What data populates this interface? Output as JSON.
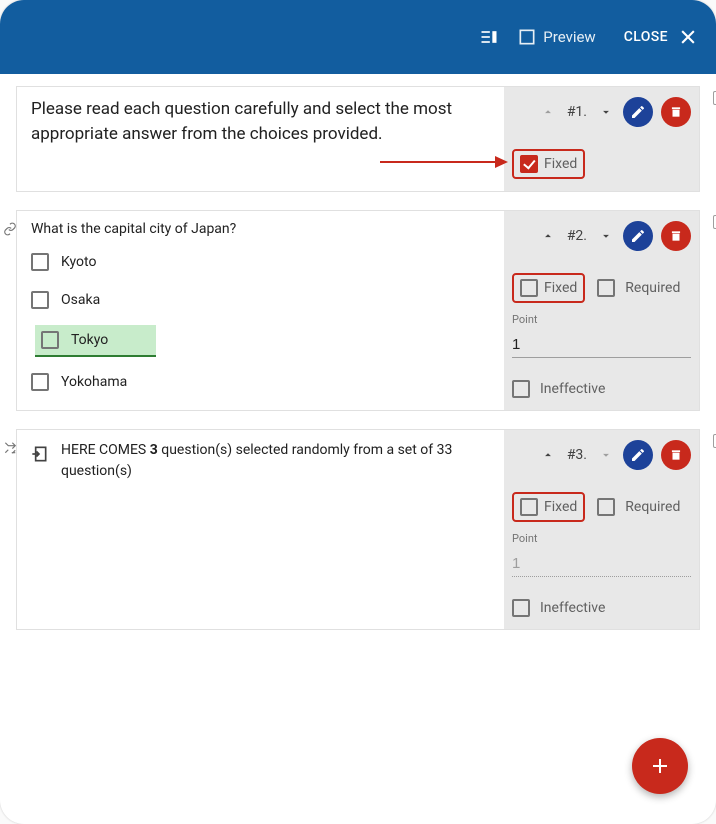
{
  "topbar": {
    "preview_label": "Preview",
    "close_label": "CLOSE"
  },
  "cards": [
    {
      "type": "instruction",
      "number_label": "#1.",
      "text": "Please read each question carefully and select the most appropriate answer from the choices provided.",
      "fixed_label": "Fixed",
      "fixed_checked": true,
      "up_enabled": false,
      "down_enabled": true
    },
    {
      "type": "question",
      "number_label": "#2.",
      "question_text": "What is the capital city of Japan?",
      "choices": [
        "Kyoto",
        "Osaka",
        "Tokyo",
        "Yokohama"
      ],
      "correct_index": 2,
      "fixed_label": "Fixed",
      "fixed_checked": false,
      "required_label": "Required",
      "required_checked": false,
      "point_label": "Point",
      "point_value": "1",
      "ineffective_label": "Ineffective",
      "ineffective_checked": false,
      "up_enabled": true,
      "down_enabled": true,
      "linked": true
    },
    {
      "type": "random",
      "number_label": "#3.",
      "random_count": "3",
      "random_total": "33",
      "random_prefix": "HERE COMES ",
      "random_mid1": " question(s) selected randomly from a set of ",
      "random_mid2": " question(s)",
      "fixed_label": "Fixed",
      "fixed_checked": false,
      "required_label": "Required",
      "required_checked": false,
      "point_label": "Point",
      "point_value": "1",
      "point_disabled": true,
      "ineffective_label": "Ineffective",
      "ineffective_checked": false,
      "up_enabled": true,
      "down_enabled": false,
      "shuffle_icon": true
    }
  ]
}
